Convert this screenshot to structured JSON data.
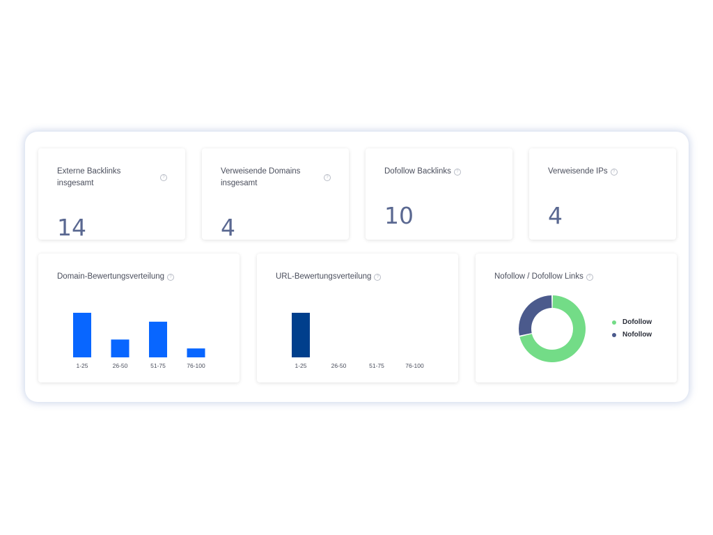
{
  "stats": [
    {
      "title": "Externe Backlinks insgesamt",
      "value": "14"
    },
    {
      "title": "Verweisende Domains insgesamt",
      "value": "4"
    },
    {
      "title": "Dofollow Backlinks",
      "value": "10"
    },
    {
      "title": "Verweisende IPs",
      "value": "4"
    }
  ],
  "info_icon": "info-icon",
  "chart_data": [
    {
      "type": "bar",
      "title": "Domain-Bewertungsverteilung",
      "categories": [
        "1-25",
        "26-50",
        "51-75",
        "76-100"
      ],
      "values": [
        5,
        2,
        4,
        1
      ],
      "ylim": [
        0,
        5
      ],
      "color": "#0866ff",
      "grid": false
    },
    {
      "type": "bar",
      "title": "URL-Bewertungsverteilung",
      "categories": [
        "1-25",
        "26-50",
        "51-75",
        "76-100"
      ],
      "values": [
        4,
        0,
        0,
        0
      ],
      "ylim": [
        0,
        4
      ],
      "color": "#003f8c",
      "grid": false
    },
    {
      "type": "pie",
      "title": "Nofollow / Dofollow Links",
      "labels": [
        "Dofollow",
        "Nofollow"
      ],
      "values": [
        10,
        4
      ],
      "colors": [
        "#73dc87",
        "#4b5a8c"
      ],
      "legend": "right"
    }
  ]
}
